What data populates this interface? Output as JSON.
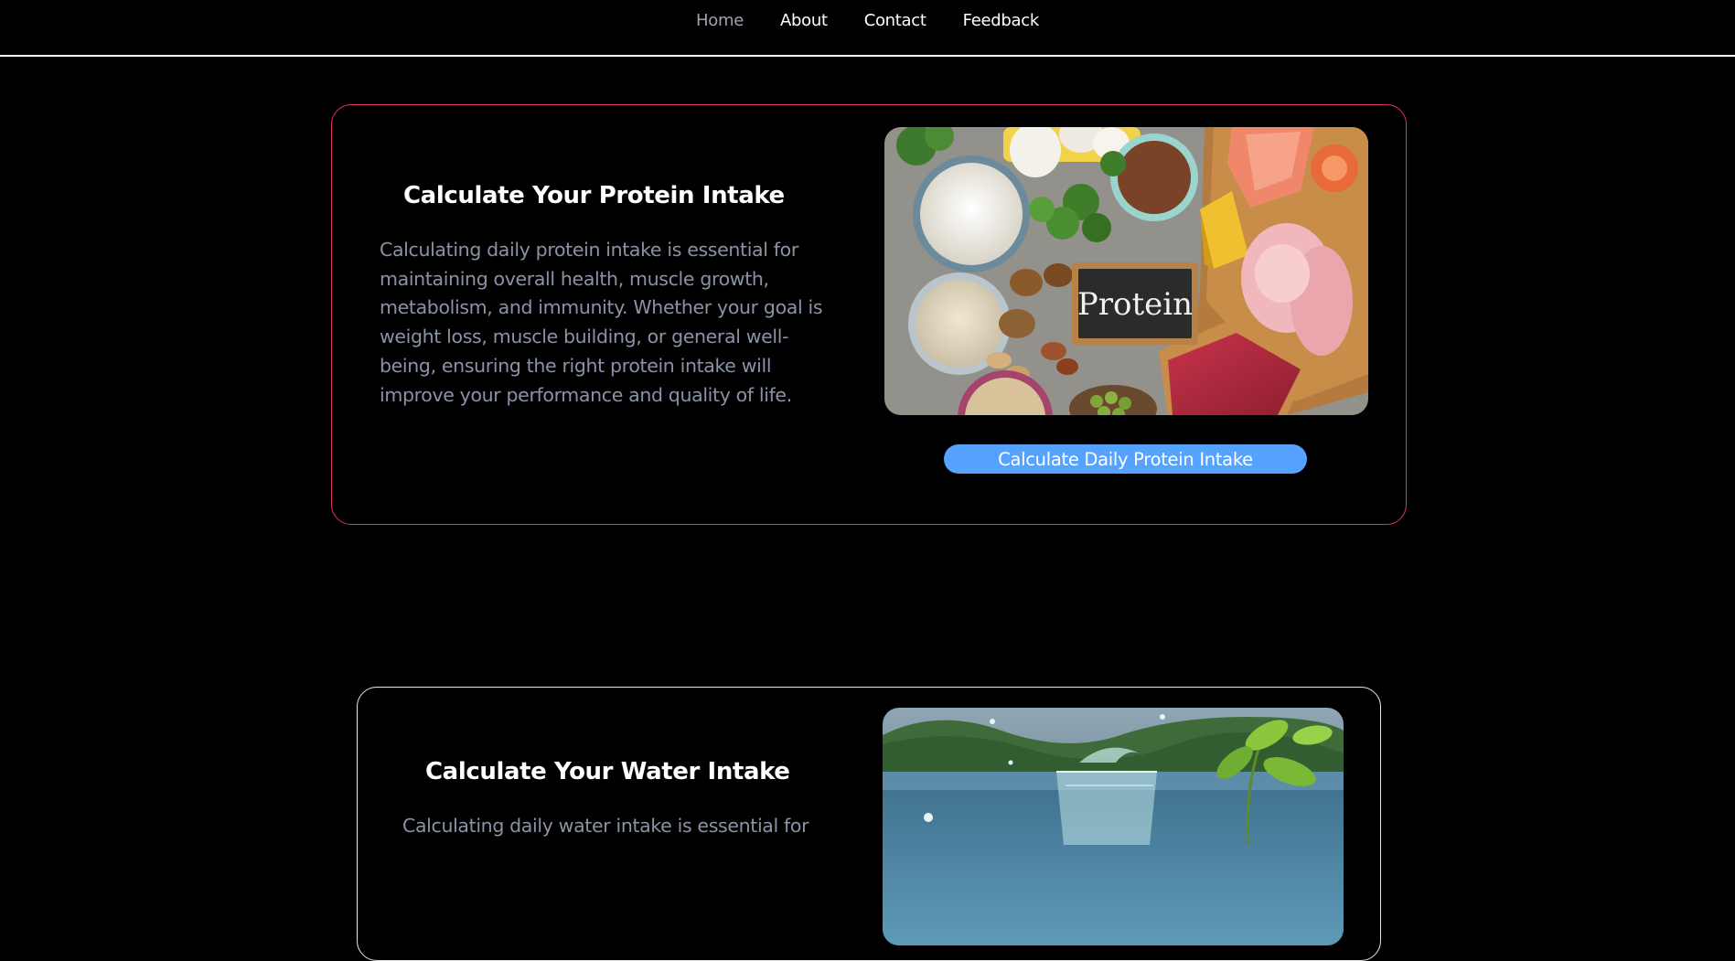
{
  "nav": {
    "items": [
      {
        "label": "Home",
        "active": true
      },
      {
        "label": "About",
        "active": false
      },
      {
        "label": "Contact",
        "active": false
      },
      {
        "label": "Feedback",
        "active": false
      }
    ]
  },
  "protein_card": {
    "title": "Calculate Your Protein Intake",
    "description": "Calculating daily protein intake is essential for maintaining overall health, muscle growth, metabolism, and immunity. Whether your goal is weight loss, muscle building, or general well-being, ensuring the right protein intake will improve your performance and quality of life.",
    "image_sign_text": "Protein",
    "button_label": "Calculate Daily Protein Intake"
  },
  "water_card": {
    "title": "Calculate Your Water Intake",
    "description": "Calculating daily water intake is essential for"
  },
  "colors": {
    "background": "#000000",
    "nav_active": "#9ca3af",
    "protein_border": "#e0307a",
    "water_border": "#e5e7eb",
    "button": "#55a2ff",
    "body_text": "#8a93a6"
  }
}
